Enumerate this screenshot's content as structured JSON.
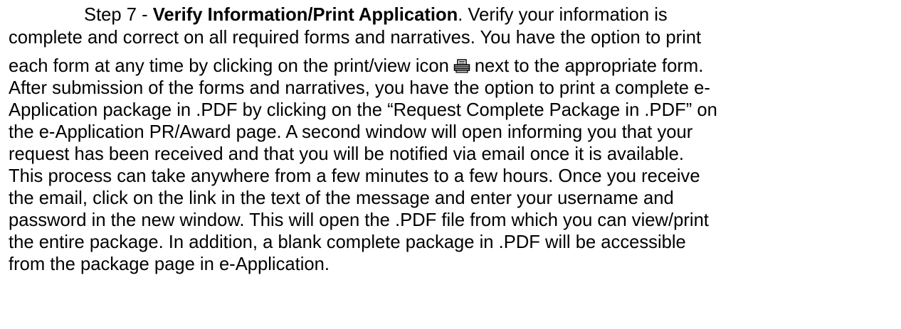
{
  "paragraph": {
    "step_prefix": "Step 7 - ",
    "step_title": "Verify Information/Print Application",
    "lines": [
      ". Verify your information is",
      "complete and correct on all required forms and narratives. You have the option to print",
      "each form at any time by clicking on the print/view icon",
      "next to the appropriate form.",
      "After submission of the forms and narratives, you have the option to print a complete e-",
      "Application package in .PDF by clicking on the “Request Complete Package in .PDF” on",
      "the e-Application PR/Award page.  A second window will open informing you that your",
      "request has been received and that you will be notified via email once it is available.",
      "This process can take anywhere from a few minutes to a few hours.  Once you receive",
      "the email, click on the link in the text of the message and enter your username and",
      "password in the new window.  This will open the .PDF file from which you can view/print",
      "the entire package. In addition, a blank complete package in .PDF will be accessible",
      "from the package page in e-Application."
    ],
    "icon": "printer-icon"
  }
}
